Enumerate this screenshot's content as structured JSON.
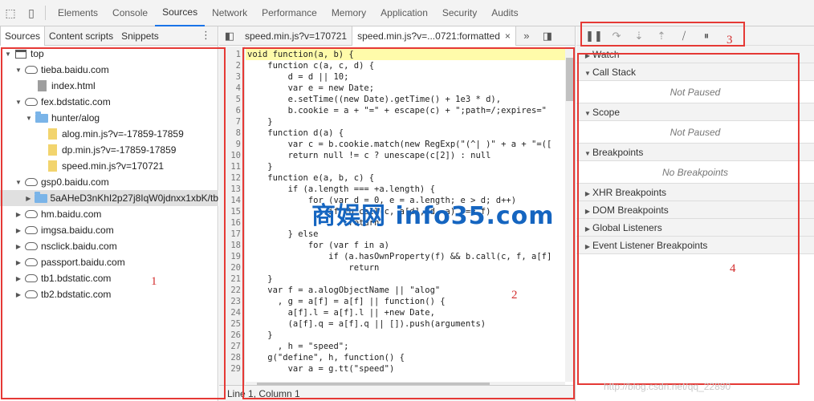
{
  "top_tabs": [
    "Elements",
    "Console",
    "Sources",
    "Network",
    "Performance",
    "Memory",
    "Application",
    "Security",
    "Audits"
  ],
  "navigator": {
    "tabs": [
      "Sources",
      "Content scripts",
      "Snippets"
    ],
    "tree": [
      {
        "label": "top",
        "level": 0,
        "icon": "frame-icon",
        "expand": "open"
      },
      {
        "label": "tieba.baidu.com",
        "level": 1,
        "icon": "cloud-icon",
        "expand": "open"
      },
      {
        "label": "index.html",
        "level": 2,
        "icon": "file-icon",
        "expand": "none"
      },
      {
        "label": "fex.bdstatic.com",
        "level": 1,
        "icon": "cloud-icon",
        "expand": "open"
      },
      {
        "label": "hunter/alog",
        "level": 2,
        "icon": "folder-icon",
        "expand": "open"
      },
      {
        "label": "alog.min.js?v=-17859-17859",
        "level": 3,
        "icon": "js-file-icon",
        "expand": "none"
      },
      {
        "label": "dp.min.js?v=-17859-17859",
        "level": 3,
        "icon": "js-file-icon",
        "expand": "none"
      },
      {
        "label": "speed.min.js?v=170721",
        "level": 3,
        "icon": "js-file-icon",
        "expand": "none"
      },
      {
        "label": "gsp0.baidu.com",
        "level": 1,
        "icon": "cloud-icon",
        "expand": "open"
      },
      {
        "label": "5aAHeD3nKhI2p27j8IqW0jdnxx1xbK/tb",
        "level": 2,
        "icon": "folder-icon",
        "expand": "closed",
        "selected": true
      },
      {
        "label": "hm.baidu.com",
        "level": 1,
        "icon": "cloud-icon",
        "expand": "closed"
      },
      {
        "label": "imgsa.baidu.com",
        "level": 1,
        "icon": "cloud-icon",
        "expand": "closed"
      },
      {
        "label": "nsclick.baidu.com",
        "level": 1,
        "icon": "cloud-icon",
        "expand": "closed"
      },
      {
        "label": "passport.baidu.com",
        "level": 1,
        "icon": "cloud-icon",
        "expand": "closed"
      },
      {
        "label": "tb1.bdstatic.com",
        "level": 1,
        "icon": "cloud-icon",
        "expand": "closed"
      },
      {
        "label": "tb2.bdstatic.com",
        "level": 1,
        "icon": "cloud-icon",
        "expand": "closed"
      }
    ]
  },
  "editor": {
    "tabs": [
      {
        "label": "speed.min.js?v=170721",
        "active": false
      },
      {
        "label": "speed.min.js?v=...0721:formatted",
        "active": true
      }
    ],
    "close_glyph": "×",
    "more_glyph": "»",
    "lines": [
      "void function(a, b) {",
      "    function c(a, c, d) {",
      "        d = d || 10;",
      "        var e = new Date;",
      "        e.setTime((new Date).getTime() + 1e3 * d),",
      "        b.cookie = a + \"=\" + escape(c) + \";path=/;expires=\"",
      "    }",
      "    function d(a) {",
      "        var c = b.cookie.match(new RegExp(\"(^| )\" + a + \"=([",
      "        return null != c ? unescape(c[2]) : null",
      "    }",
      "    function e(a, b, c) {",
      "        if (a.length === +a.length) {",
      "            for (var d = 0, e = a.length; e > d; d++)",
      "                if (b.call(c, a[d], d, a) === f)",
      "                    return",
      "        } else",
      "            for (var f in a)",
      "                if (a.hasOwnProperty(f) && b.call(c, f, a[f]",
      "                    return",
      "    }",
      "    var f = a.alogObjectName || \"alog\"",
      "      , g = a[f] = a[f] || function() {",
      "        a[f].l = a[f].l || +new Date,",
      "        (a[f].q = a[f].q || []).push(arguments)",
      "    }",
      "      , h = \"speed\";",
      "    g(\"define\", h, function() {",
      "        var a = g.tt(\"speed\")"
    ],
    "status": "Line 1, Column 1"
  },
  "debugger": {
    "sections": [
      {
        "title": "Watch",
        "open": false
      },
      {
        "title": "Call Stack",
        "open": true,
        "body": "Not Paused"
      },
      {
        "title": "Scope",
        "open": true,
        "body": "Not Paused"
      },
      {
        "title": "Breakpoints",
        "open": true,
        "body": "No Breakpoints"
      },
      {
        "title": "XHR Breakpoints",
        "open": false
      },
      {
        "title": "DOM Breakpoints",
        "open": false
      },
      {
        "title": "Global Listeners",
        "open": false
      },
      {
        "title": "Event Listener Breakpoints",
        "open": false
      }
    ]
  },
  "annotations": [
    "1",
    "2",
    "3",
    "4"
  ],
  "watermark": "商娱网 info35.com",
  "watermark_small": "http://blog.csdn.net/qq_22890"
}
